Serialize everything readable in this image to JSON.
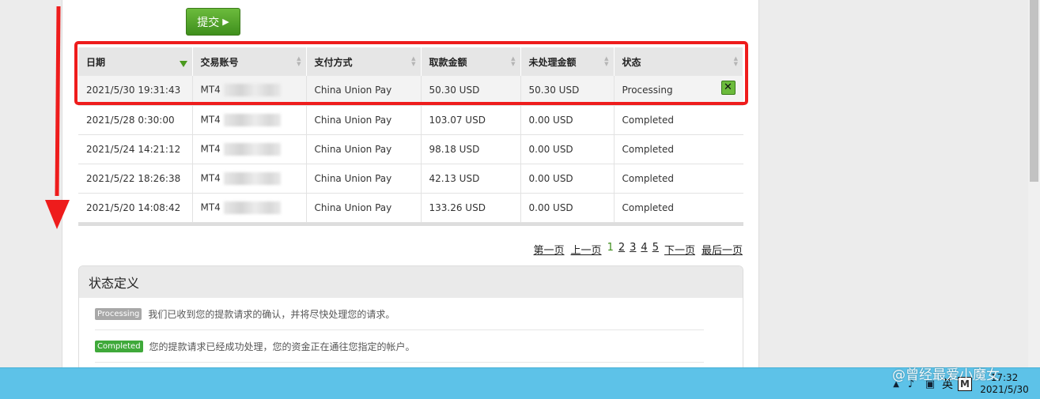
{
  "submit": {
    "label": "提交",
    "arrow": "▶"
  },
  "table": {
    "columns": [
      "日期",
      "交易账号",
      "支付方式",
      "取款金额",
      "未处理金额",
      "状态"
    ],
    "rows": [
      {
        "date": "2021/5/30 19:31:43",
        "account": "MT4",
        "method": "China Union Pay",
        "amount": "50.30 USD",
        "unprocessed": "50.30 USD",
        "status": "Processing",
        "cancel": "✕"
      },
      {
        "date": "2021/5/28 0:30:00",
        "account": "MT4",
        "method": "China Union Pay",
        "amount": "103.07 USD",
        "unprocessed": "0.00 USD",
        "status": "Completed"
      },
      {
        "date": "2021/5/24 14:21:12",
        "account": "MT4",
        "method": "China Union Pay",
        "amount": "98.18 USD",
        "unprocessed": "0.00 USD",
        "status": "Completed"
      },
      {
        "date": "2021/5/22 18:26:38",
        "account": "MT4",
        "method": "China Union Pay",
        "amount": "42.13 USD",
        "unprocessed": "0.00 USD",
        "status": "Completed"
      },
      {
        "date": "2021/5/20 14:08:42",
        "account": "MT4",
        "method": "China Union Pay",
        "amount": "133.26 USD",
        "unprocessed": "0.00 USD",
        "status": "Completed"
      }
    ]
  },
  "pager": {
    "first": "第一页",
    "prev": "上一页",
    "pages": [
      "1",
      "2",
      "3",
      "4",
      "5"
    ],
    "current": "1",
    "next": "下一页",
    "last": "最后一页"
  },
  "status_def": {
    "title": "状态定义",
    "items": [
      {
        "badge": "Processing",
        "text": "我们已收到您的提款请求的确认，并将尽快处理您的请求。"
      },
      {
        "badge": "Completed",
        "text": "您的提款请求已经成功处理，您的资金正在通往您指定的帐户。"
      }
    ]
  },
  "taskbar": {
    "ime": "英",
    "m": "M",
    "time": "17:32",
    "date": "2021/5/30"
  },
  "watermark": "@曾经最爱小魔女",
  "colors": {
    "highlight": "#ee1c1c",
    "accent_green": "#4a9a1e",
    "taskbar": "#5dc2e8"
  }
}
